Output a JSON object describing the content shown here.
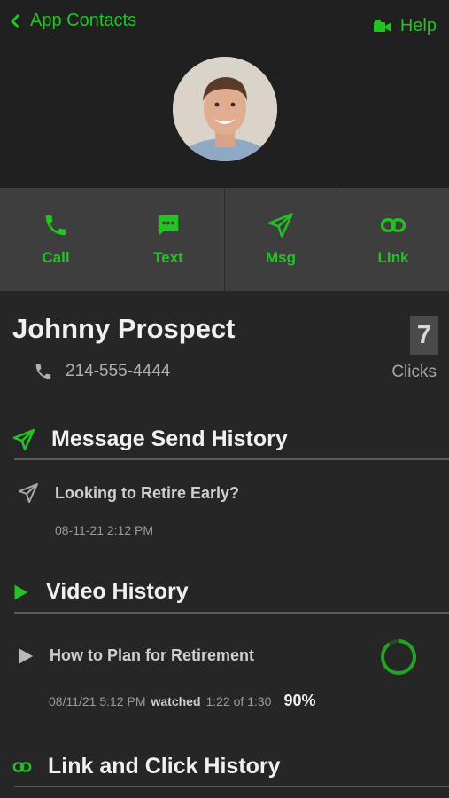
{
  "header": {
    "back_label": "App Contacts",
    "help_label": "Help"
  },
  "actions": [
    {
      "label": "Call",
      "icon": "phone-icon"
    },
    {
      "label": "Text",
      "icon": "chat-bubble-icon"
    },
    {
      "label": "Msg",
      "icon": "paper-plane-icon"
    },
    {
      "label": "Link",
      "icon": "link-icon"
    }
  ],
  "contact": {
    "name": "Johnny Prospect",
    "phone": "214-555-4444",
    "clicks_count": "7",
    "clicks_label": "Clicks"
  },
  "message_history": {
    "title": "Message Send History",
    "items": [
      {
        "title": "Looking to Retire Early?",
        "date": "08-11-21 2:12 PM"
      }
    ]
  },
  "video_history": {
    "title": "Video History",
    "items": [
      {
        "title": "How to Plan for Retirement",
        "date": "08/11/21 5:12 PM",
        "watched_label": "watched",
        "progress_text": "1:22 of 1:30",
        "percent_text": "90%",
        "percent_value": 0.9
      }
    ]
  },
  "link_history": {
    "title": "Link and Click History"
  },
  "colors": {
    "accent": "#22c322",
    "background": "#262626",
    "header_bg": "#202020",
    "action_bar_bg": "#3e3e3e"
  }
}
